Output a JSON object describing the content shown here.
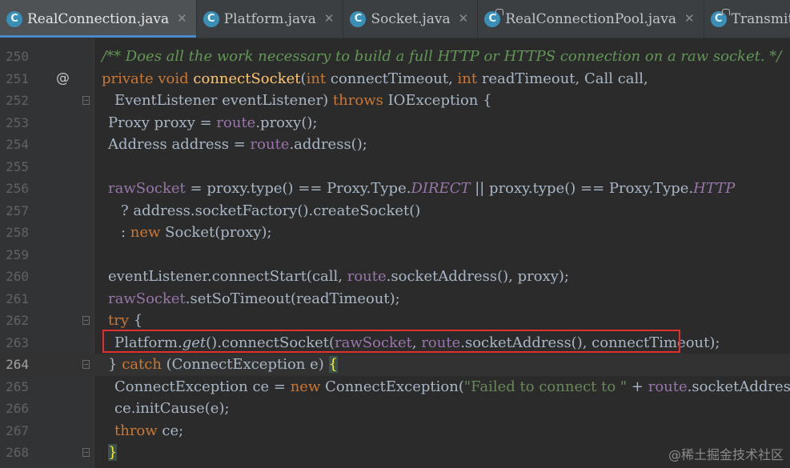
{
  "tabs": [
    {
      "label": "RealConnection.java",
      "icon": "java-class-icon",
      "icon_letter": "C",
      "close": "✕",
      "active": true
    },
    {
      "label": "Platform.java",
      "icon": "java-class-icon",
      "icon_letter": "C",
      "close": "✕",
      "active": false
    },
    {
      "label": "Socket.java",
      "icon": "java-class-icon",
      "icon_letter": "C",
      "close": "✕",
      "active": false
    },
    {
      "label": "RealConnectionPool.java",
      "icon": "java-class-icon",
      "icon_letter": "C",
      "close": "✕",
      "active": false
    },
    {
      "label": "Transmitter",
      "icon": "java-class-icon",
      "icon_letter": "C",
      "close": "",
      "active": false
    }
  ],
  "editor": {
    "line_numbers": [
      "250",
      "251",
      "252",
      "253",
      "254",
      "255",
      "256",
      "257",
      "258",
      "259",
      "260",
      "261",
      "262",
      "263",
      "264",
      "265",
      "266",
      "267",
      "268"
    ],
    "override_marker": "@",
    "l250": {
      "comment": "/** Does all the work necessary to build a full HTTP or HTTPS connection on a raw socket. */"
    },
    "l251": {
      "t1": "private void ",
      "t2": "connectSocket",
      "t3": "(",
      "t4": "int ",
      "t5": "connectTimeout, ",
      "t6": "int ",
      "t7": "readTimeout, Call call,"
    },
    "l252": {
      "t1": "EventListener eventListener) ",
      "t2": "throws ",
      "t3": "IOException {"
    },
    "l253": {
      "t1": "Proxy proxy = ",
      "t2": "route",
      ".": "",
      "t3": ".proxy();"
    },
    "l254": {
      "t1": "Address address = ",
      "t2": "route",
      "t3": ".address();"
    },
    "l256": {
      "t1": "rawSocket",
      " t2": "",
      "t2": " = proxy.type() == Proxy.Type.",
      "t3": "DIRECT",
      "t4": " || proxy.type() == Proxy.Type.",
      "t5": "HTTP"
    },
    "l257": {
      "t1": "? address.socketFactory().createSocket()"
    },
    "l258": {
      "t1": ": ",
      "t2": "new ",
      "t3": "Socket(proxy);"
    },
    "l260": {
      "t1": "eventListener.connectStart(call, ",
      "t2": "route",
      "t3": ".socketAddress(), proxy);"
    },
    "l261": {
      "t1": "rawSocket",
      "t2": ".setSoTimeout(readTimeout);"
    },
    "l262": {
      "t1": "try ",
      "t2": "{"
    },
    "l263": {
      "t1": "Platform.",
      "t2": "get",
      "t3": "().connectSocket(",
      "t4": "rawSocket",
      ",": "",
      "t5": ", ",
      "t6": "route",
      "t7": ".socketAddress(), connectTimeout);"
    },
    "l264": {
      "t1": "} ",
      "t2": "catch ",
      "t3": "(ConnectException e) ",
      "t4": "{"
    },
    "l265": {
      "t1": "ConnectException ce = ",
      "t2": "new ",
      "t3": "ConnectException(",
      "t4": "\"Failed to connect to \"",
      "t5": " + ",
      "t6": "route",
      "t7": ".socketAddress());"
    },
    "l266": {
      "t1": "ce.initCause(e);"
    },
    "l267": {
      "t1": "throw ",
      "t2": "ce;"
    },
    "l268": {
      "t1": "}"
    }
  },
  "colors": {
    "background": "#2b2b2b",
    "keyword": "#cc7832",
    "method": "#ffc66d",
    "field": "#9876aa",
    "comment": "#629755",
    "string": "#6a8759",
    "text": "#a9b7c6",
    "highlight_box": "#e0302f",
    "tab_underline": "#4a88c7"
  },
  "watermark": "@稀土掘金技术社区"
}
